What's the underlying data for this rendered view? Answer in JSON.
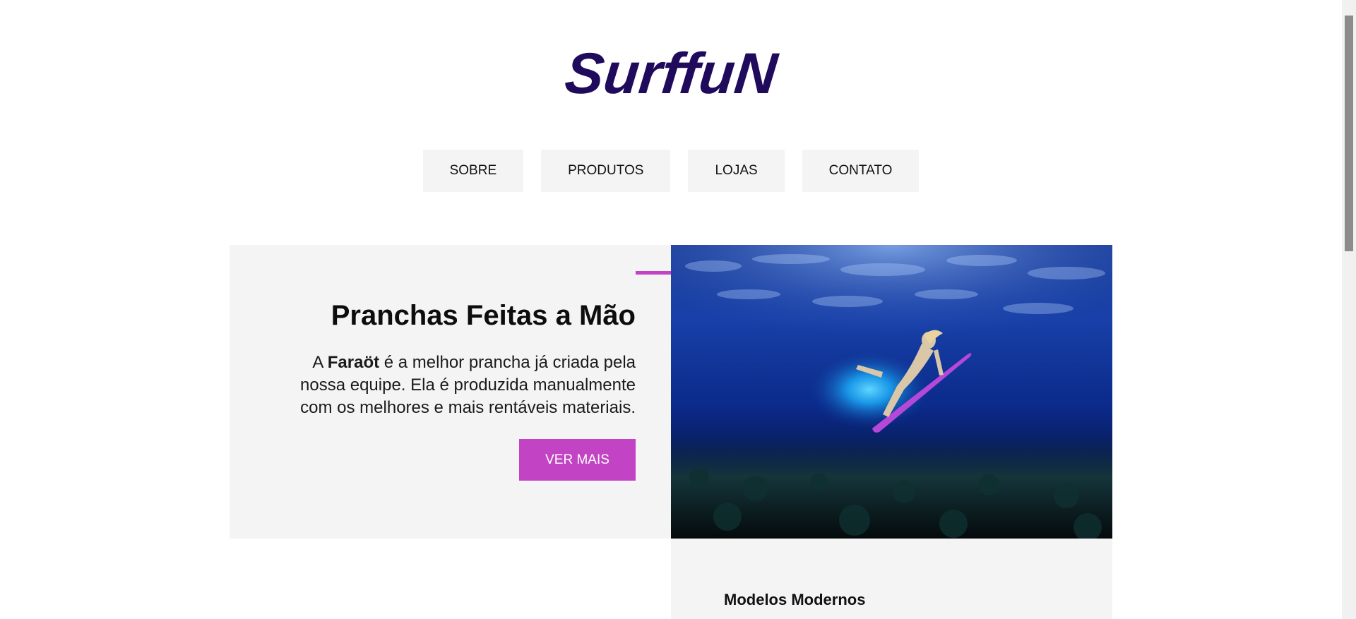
{
  "logo": {
    "text": "SurffuN",
    "color": "#1f0a5c"
  },
  "nav": {
    "items": [
      {
        "label": "SOBRE"
      },
      {
        "label": "PRODUTOS"
      },
      {
        "label": "LOJAS"
      },
      {
        "label": "CONTATO"
      }
    ]
  },
  "hero": {
    "title": "Pranchas Feitas a Mão",
    "body_prefix": "A ",
    "body_bold": "Faraöt",
    "body_suffix": " é a melhor prancha já criada pela nossa equipe. Ela é produzida manualmente com os melhores e mais rentáveis materiais.",
    "button_label": "VER MAIS",
    "accent_color": "#c244c4"
  },
  "section2": {
    "title": "Modelos Modernos"
  }
}
